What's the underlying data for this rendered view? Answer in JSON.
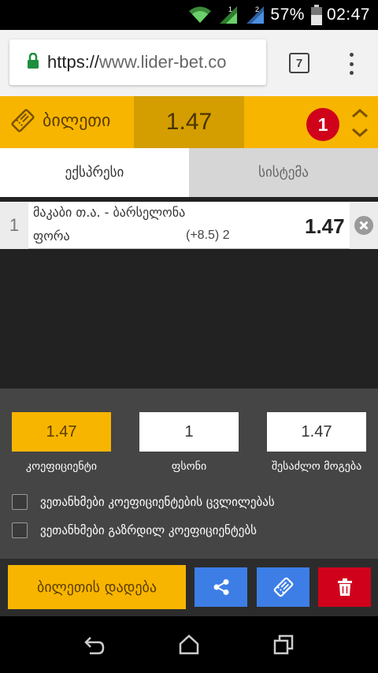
{
  "status_bar": {
    "battery": "57%",
    "time": "02:47",
    "wifi_icon": "wifi-icon",
    "signal_icon": "signal-icon",
    "battery_icon": "battery-icon"
  },
  "browser": {
    "url_scheme": "https://",
    "url_rest": "www.lider-bet.co",
    "tab_count": "7"
  },
  "ticket": {
    "label": "ბილეთი",
    "total_odds": "1.47",
    "bet_count": "1"
  },
  "tabs": [
    {
      "label": "ექსპრესი",
      "active": true
    },
    {
      "label": "სისტემა",
      "active": false
    }
  ],
  "bets": [
    {
      "index": "1",
      "match": "მაკაბი თ.ა. - ბარსელონა",
      "market": "ფორა",
      "line": "(+8.5) 2",
      "odds": "1.47"
    }
  ],
  "summary": {
    "coefficient": "1.47",
    "stake": "1",
    "possible_win": "1.47",
    "coefficient_label": "კოეფიციენტი",
    "stake_label": "ფსონი",
    "possible_win_label": "შესაძლო მოგება"
  },
  "options": {
    "accept_odds_changes": "ვეთანხმები კოეფიციენტების ცვლილებას",
    "accept_increased_odds": "ვეთანხმები გაზრდილ კოეფიციენტებს"
  },
  "actions": {
    "place_bet": "ბილეთის დადება"
  },
  "colors": {
    "accent": "#f7b500",
    "accent_dark": "#d49e00",
    "badge": "#d0021b",
    "blue": "#3d7ee6",
    "red": "#d0021b"
  }
}
